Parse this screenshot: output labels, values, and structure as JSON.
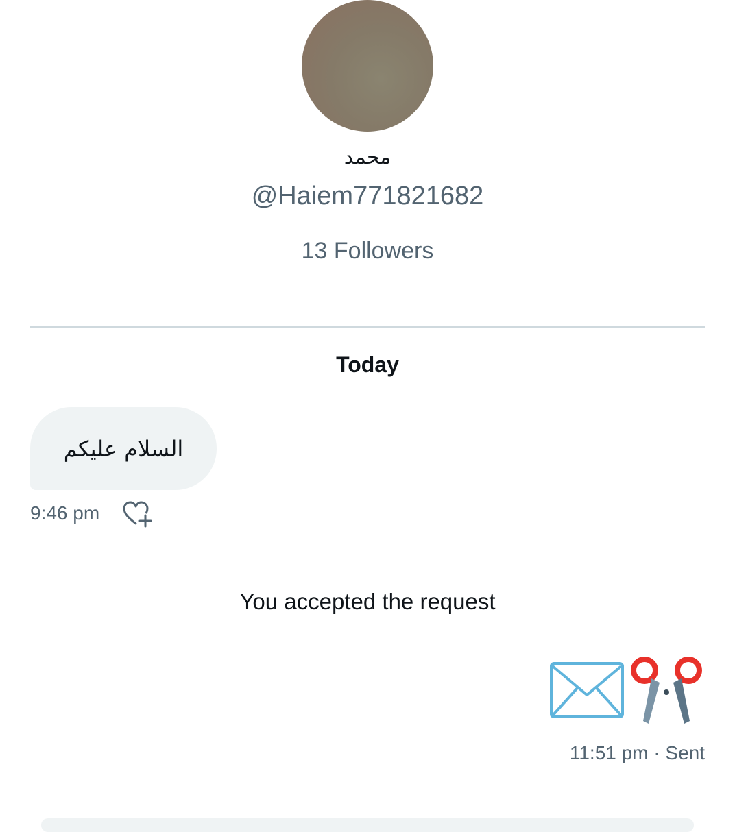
{
  "profile": {
    "display_name": "محمد",
    "handle": "@Haiem771821682",
    "followers": "13 Followers"
  },
  "conversation": {
    "date_separator": "Today",
    "messages": [
      {
        "direction": "incoming",
        "text": "السلام عليكم",
        "time": "9:46 pm"
      },
      {
        "direction": "system",
        "text": "You accepted the request"
      },
      {
        "direction": "outgoing",
        "emojis": [
          "envelope-icon",
          "scissors-icon"
        ],
        "time": "11:51 pm · Sent"
      }
    ]
  },
  "colors": {
    "primary_text": "#0f1419",
    "secondary_text": "#536471",
    "bubble_incoming": "#eff3f4",
    "divider": "#cfd9de"
  },
  "icons": {
    "react": "heart-plus-icon",
    "envelope": "envelope-icon",
    "scissors": "scissors-icon"
  }
}
